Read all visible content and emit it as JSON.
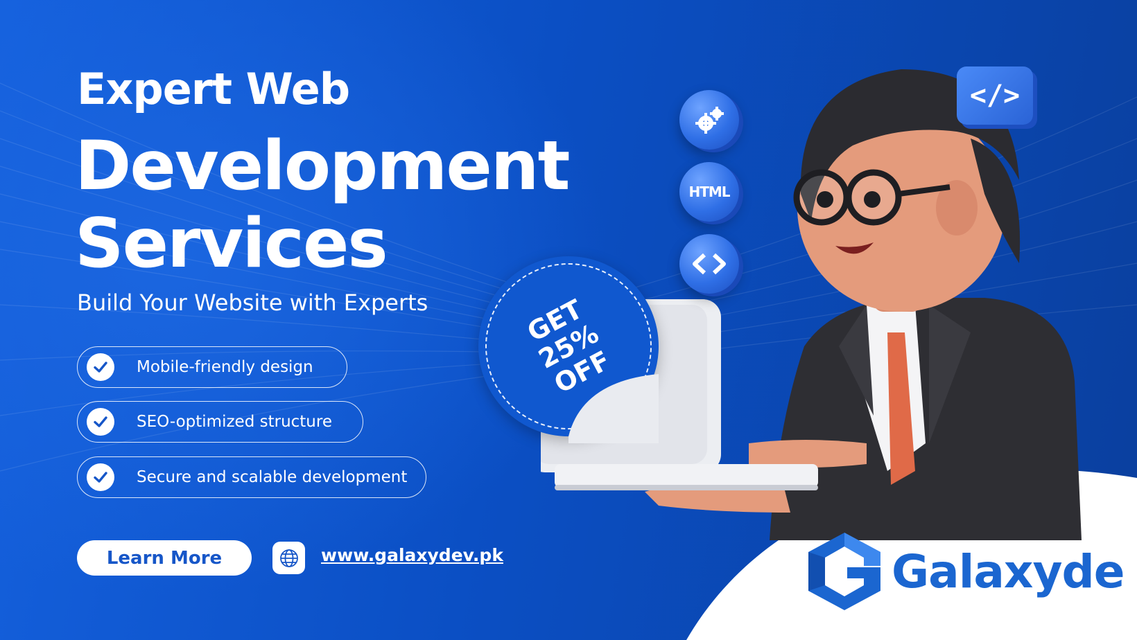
{
  "headline": {
    "line1": "Expert Web",
    "line2": "Development",
    "line3": "Services"
  },
  "subtitle": "Build Your Website with Experts",
  "features": [
    {
      "label": "Mobile-friendly design",
      "icon": "check-icon"
    },
    {
      "label": "SEO-optimized structure",
      "icon": "check-icon"
    },
    {
      "label": "Secure and scalable development",
      "icon": "check-icon"
    }
  ],
  "cta": {
    "label": "Learn More"
  },
  "website": {
    "icon": "globe-icon",
    "url": "www.galaxydev.pk"
  },
  "badge": {
    "line1": "GET",
    "line2": "25%",
    "line3": "OFF"
  },
  "tech_icons": [
    {
      "icon": "gears-icon"
    },
    {
      "icon": "html-icon",
      "label": "HTML"
    },
    {
      "icon": "code-brackets-icon"
    }
  ],
  "speech_bubble": {
    "icon": "code-tag-icon",
    "label": "</>"
  },
  "logo": {
    "name": "Galaxyde"
  },
  "colors": {
    "background": "#0b4fc4",
    "accent": "#1656c8",
    "logo_blue": "#1b66d0",
    "white": "#ffffff"
  }
}
